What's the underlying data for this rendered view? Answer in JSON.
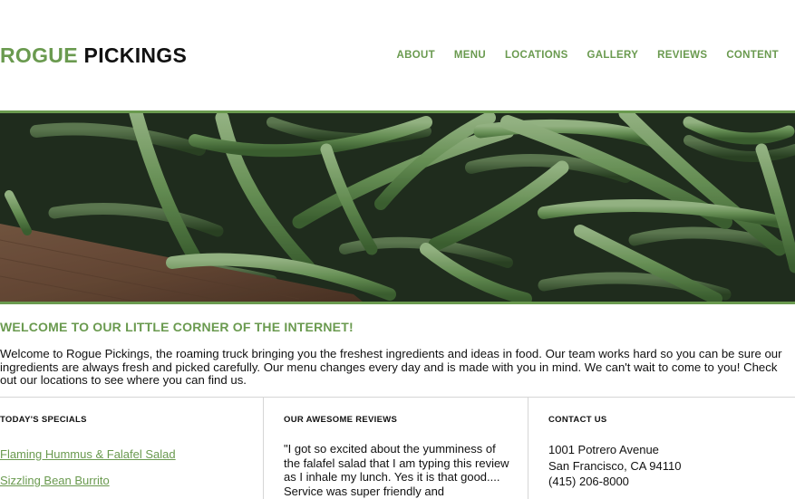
{
  "brand": {
    "name_accent": "ROGUE",
    "name_rest": "PICKINGS",
    "accent_color": "#6a9a4f"
  },
  "nav": {
    "items": [
      "ABOUT",
      "MENU",
      "LOCATIONS",
      "GALLERY",
      "REVIEWS",
      "CONTENT"
    ]
  },
  "hero": {
    "image": "green-beans-photo"
  },
  "welcome": {
    "title": "WELCOME TO OUR LITTLE CORNER OF THE INTERNET!",
    "body": "Welcome to Rogue Pickings, the roaming truck bringing you the freshest ingredients and ideas in food. Our team works hard so you can be sure our ingredients are always fresh and picked carefully. Our menu changes every day and is made with you in mind. We can't wait to come to you! Check out our locations to see where you can find us."
  },
  "specials": {
    "title": "TODAY'S SPECIALS",
    "items": [
      "Flaming Hummus & Falafel Salad",
      "Sizzling Bean Burrito"
    ]
  },
  "reviews": {
    "title": "OUR AWESOME REVIEWS",
    "text": "\"I got so excited about the yumminess of the falafel salad that I am typing this review as I inhale my lunch. Yes it is that good.... Service was super friendly and"
  },
  "contact": {
    "title": "CONTACT US",
    "address_line1": "1001 Potrero Avenue",
    "address_line2": "San Francisco, CA 94110",
    "phone": "(415) 206-8000"
  }
}
